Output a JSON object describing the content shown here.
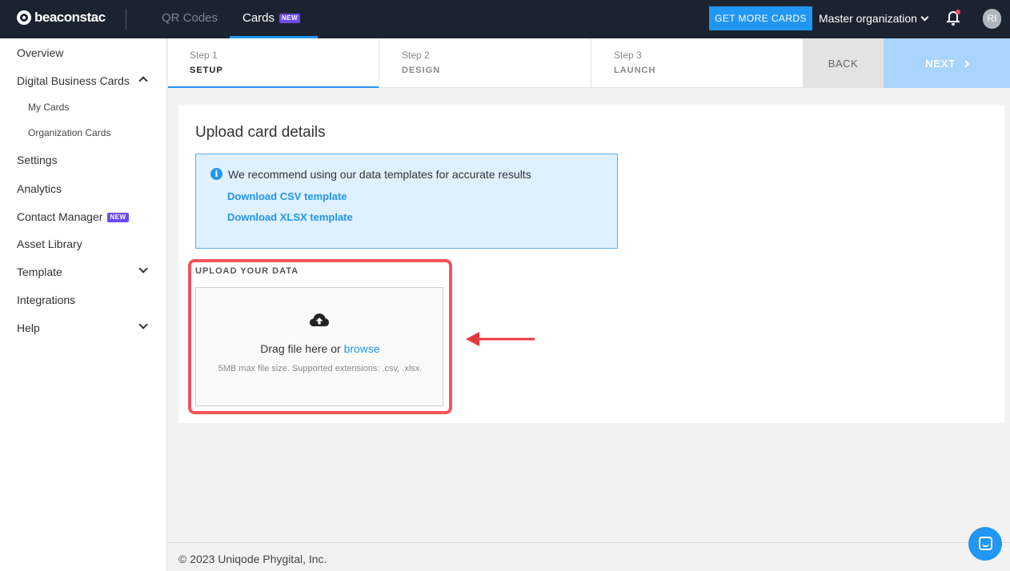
{
  "topbar": {
    "logo_text": "beaconstac",
    "tabs": [
      {
        "label": "QR Codes"
      },
      {
        "label": "Cards",
        "badge": "NEW"
      }
    ],
    "get_more_label": "GET MORE CARDS",
    "org_label": "Master organization",
    "avatar_initials": "RI",
    "accent_color": "#2196f3",
    "bar_color": "#1b2330"
  },
  "sidebar": {
    "items": [
      {
        "label": "Overview"
      },
      {
        "label": "Digital Business Cards",
        "expanded": true
      },
      {
        "label": "My Cards"
      },
      {
        "label": "Organization Cards"
      },
      {
        "label": "Settings"
      },
      {
        "label": "Analytics"
      },
      {
        "label": "Contact Manager",
        "badge": "NEW"
      },
      {
        "label": "Asset Library"
      },
      {
        "label": "Template",
        "expanded": false
      },
      {
        "label": "Integrations"
      },
      {
        "label": "Help",
        "expanded": false
      }
    ]
  },
  "stepper": {
    "steps": [
      {
        "num": "Step 1",
        "label": "SETUP",
        "active": true
      },
      {
        "num": "Step 2",
        "label": "DESIGN"
      },
      {
        "num": "Step 3",
        "label": "LAUNCH"
      }
    ],
    "back_label": "BACK",
    "next_label": "NEXT"
  },
  "main": {
    "title": "Upload card details",
    "info_text": "We recommend using our data templates for accurate results",
    "csv_link": "Download CSV template",
    "xlsx_link": "Download XLSX template",
    "upload_label": "UPLOAD YOUR DATA",
    "drop_text": "Drag file here or ",
    "browse_label": "browse",
    "drop_hint": "5MB max file size. Supported extensions: .csv, .xlsx.",
    "highlight_color": "#f2545b"
  },
  "footer": {
    "copyright": "© 2023 Uniqode Phygital, Inc."
  }
}
